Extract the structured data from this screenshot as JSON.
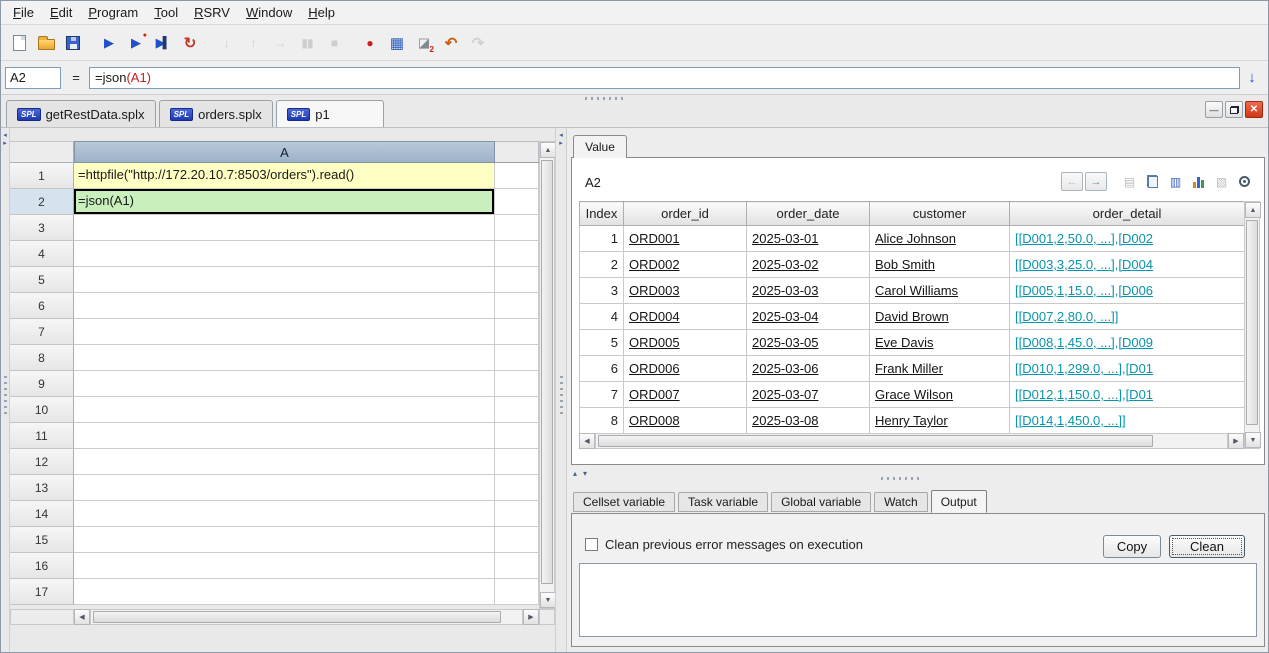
{
  "menubar": {
    "items": [
      "File",
      "Edit",
      "Program",
      "Tool",
      "RSRV",
      "Window",
      "Help"
    ]
  },
  "toolbar": {
    "run_glyph": "▶",
    "debug_glyph": "▶",
    "debug_badge": "●",
    "step_glyph": "▶",
    "step_bar": "▌",
    "recalc_glyph": "↻",
    "stepinto_glyph": "↓",
    "stepreturn_glyph": "↑",
    "runcursor_glyph": "→",
    "pause_glyph": "▮▮",
    "stop_glyph": "■",
    "breakpoint_glyph": "●",
    "calc_glyph": "▦",
    "clear_glyph": "◪",
    "clear_badge": "2",
    "undo_glyph": "↶",
    "redo_glyph": "↷"
  },
  "formula_bar": {
    "cell_ref": "A2",
    "equals": "=",
    "fn": "=json",
    "arg": "(A1)",
    "expand_glyph": "↓"
  },
  "sheet_tabs": [
    {
      "badge": "SPL",
      "label": "getRestData.splx"
    },
    {
      "badge": "SPL",
      "label": "orders.splx"
    },
    {
      "badge": "SPL",
      "label": "p1"
    }
  ],
  "window_controls": {
    "minimize": "—",
    "close": "✕"
  },
  "splitters": {
    "left": "◂",
    "right": "▸",
    "up": "▴",
    "down": "▾"
  },
  "scrollbar": {
    "up": "▲",
    "down": "▼",
    "left": "◀",
    "right": "▶"
  },
  "grid": {
    "col_header": "A",
    "rows": [
      {
        "num": "1",
        "content": "=httpfile(\"http://172.20.10.7:8503/orders\").read()",
        "cellClass": "c-yellow"
      },
      {
        "num": "2",
        "content": "=json(A1)",
        "cellClass": "c-green c-sel",
        "hdrClass": "h-sel"
      },
      {
        "num": "3"
      },
      {
        "num": "4"
      },
      {
        "num": "5"
      },
      {
        "num": "6"
      },
      {
        "num": "7"
      },
      {
        "num": "8"
      },
      {
        "num": "9"
      },
      {
        "num": "10"
      },
      {
        "num": "11"
      },
      {
        "num": "12"
      },
      {
        "num": "13"
      },
      {
        "num": "14"
      },
      {
        "num": "15"
      },
      {
        "num": "16"
      },
      {
        "num": "17"
      }
    ]
  },
  "value_panel": {
    "tab_label": "Value",
    "cell_ref": "A2",
    "toolbar": {
      "back": "←",
      "forward": "→",
      "print": "▤",
      "list": "▥",
      "edit": "▧"
    },
    "table": {
      "headers": [
        "Index",
        "order_id",
        "order_date",
        "customer",
        "order_detail"
      ],
      "rows": [
        {
          "index": "1",
          "order_id": "ORD001",
          "order_date": "2025-03-01",
          "customer": "Alice Johnson",
          "order_detail": "[[D001,2,50.0, ...],[D002"
        },
        {
          "index": "2",
          "order_id": "ORD002",
          "order_date": "2025-03-02",
          "customer": "Bob Smith",
          "order_detail": "[[D003,3,25.0, ...],[D004"
        },
        {
          "index": "3",
          "order_id": "ORD003",
          "order_date": "2025-03-03",
          "customer": "Carol Williams",
          "order_detail": "[[D005,1,15.0, ...],[D006"
        },
        {
          "index": "4",
          "order_id": "ORD004",
          "order_date": "2025-03-04",
          "customer": "David Brown",
          "order_detail": "[[D007,2,80.0, ...]]"
        },
        {
          "index": "5",
          "order_id": "ORD005",
          "order_date": "2025-03-05",
          "customer": "Eve Davis",
          "order_detail": "[[D008,1,45.0, ...],[D009"
        },
        {
          "index": "6",
          "order_id": "ORD006",
          "order_date": "2025-03-06",
          "customer": "Frank Miller",
          "order_detail": "[[D010,1,299.0, ...],[D01"
        },
        {
          "index": "7",
          "order_id": "ORD007",
          "order_date": "2025-03-07",
          "customer": "Grace Wilson",
          "order_detail": "[[D012,1,150.0, ...],[D01"
        },
        {
          "index": "8",
          "order_id": "ORD008",
          "order_date": "2025-03-08",
          "customer": "Henry Taylor",
          "order_detail": "[[D014,1,450.0, ...]]"
        }
      ]
    }
  },
  "bottom_panel": {
    "tabs": [
      "Cellset variable",
      "Task variable",
      "Global variable",
      "Watch",
      "Output"
    ],
    "active_tab": "Output",
    "checkbox_label": "Clean previous error messages on execution",
    "checkbox_checked": false,
    "copy_button": "Copy",
    "clean_button": "Clean",
    "output_text": ""
  }
}
